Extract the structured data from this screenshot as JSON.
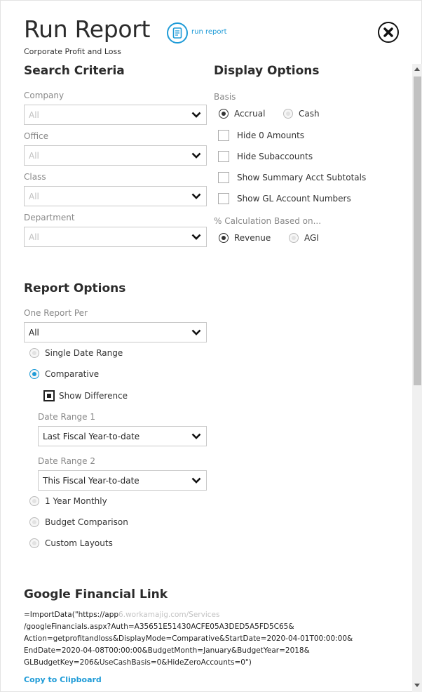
{
  "header": {
    "title": "Run Report",
    "run_link": "run report",
    "subtitle": "Corporate Profit and Loss"
  },
  "search": {
    "heading": "Search Criteria",
    "fields": [
      {
        "label": "Company",
        "value": "All"
      },
      {
        "label": "Office",
        "value": "All"
      },
      {
        "label": "Class",
        "value": "All"
      },
      {
        "label": "Department",
        "value": "All"
      }
    ]
  },
  "display": {
    "heading": "Display Options",
    "basis_label": "Basis",
    "basis_options": [
      "Accrual",
      "Cash"
    ],
    "checks": [
      "Hide 0 Amounts",
      "Hide Subaccounts",
      "Show Summary Acct Subtotals",
      "Show GL Account Numbers"
    ],
    "pct_label": "% Calculation Based on...",
    "pct_options": [
      "Revenue",
      "AGI"
    ]
  },
  "report": {
    "heading": "Report Options",
    "per_label": "One Report Per",
    "per_value": "All",
    "single_range": "Single Date Range",
    "comparative": "Comparative",
    "show_difference": "Show Difference",
    "range1_label": "Date Range 1",
    "range1_value": "Last Fiscal Year-to-date",
    "range2_label": "Date Range 2",
    "range2_value": "This Fiscal Year-to-date",
    "year_monthly": "1 Year Monthly",
    "budget_comparison": "Budget Comparison",
    "custom_layouts": "Custom Layouts"
  },
  "google": {
    "heading": "Google Financial Link",
    "line1_start": "=ImportData(\"https://app",
    "line1_faded": "6.workamajig.com/Services",
    "line2": "/googleFinancials.aspx?Auth=A35651E51430ACFE05A3DED5A5FD5C65&",
    "line3": "Action=getprofitandloss&DisplayMode=Comparative&StartDate=2020-04-01T00:00:00&",
    "line4": "EndDate=2020-04-08T00:00:00&BudgetMonth=January&BudgetYear=2018&",
    "line5": "GLBudgetKey=206&UseCashBasis=0&HideZeroAccounts=0\")",
    "copy_label": "Copy to Clipboard"
  },
  "colors": {
    "accent": "#1e9bd7",
    "text": "#333333"
  }
}
